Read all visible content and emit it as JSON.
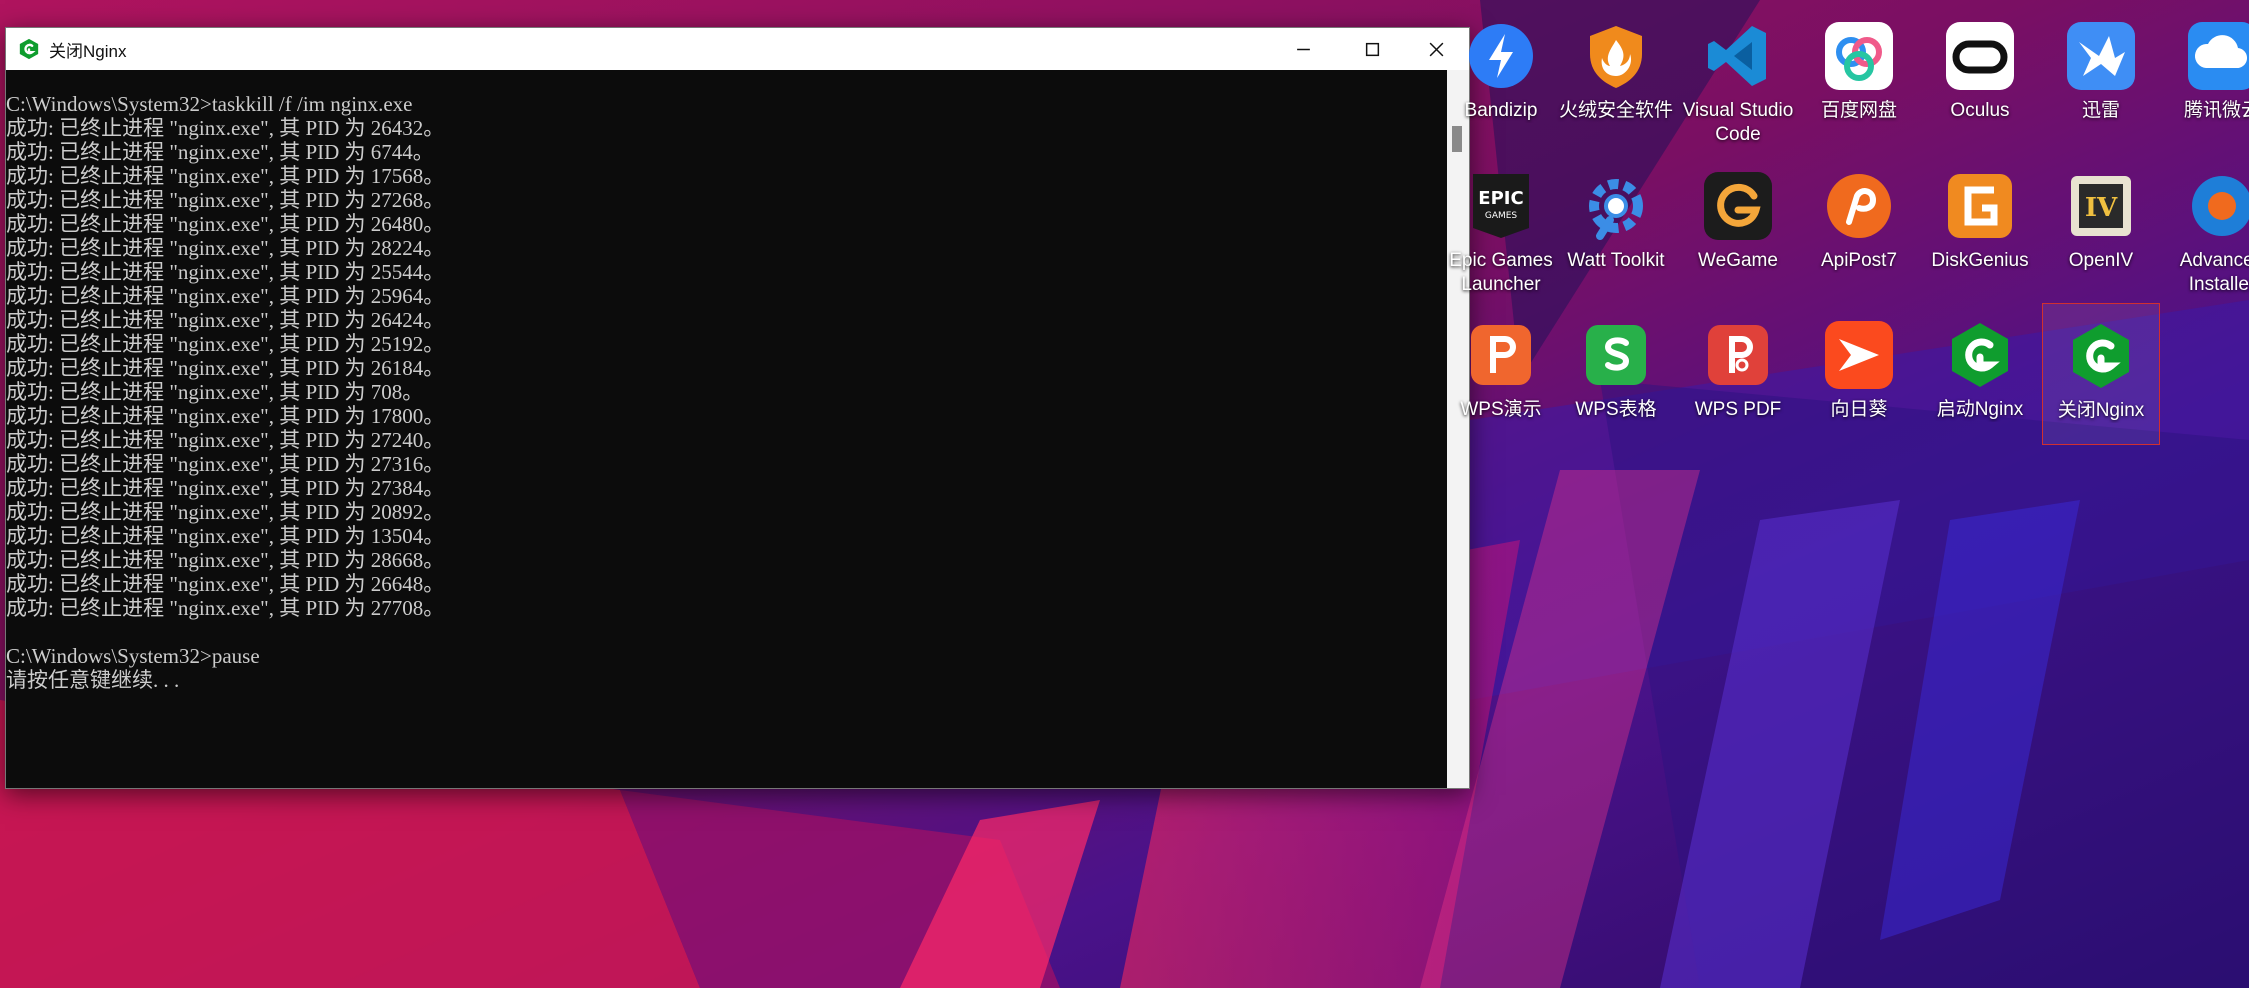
{
  "window": {
    "title": "关闭Nginx",
    "console_lines": [
      "C:\\Windows\\System32>taskkill /f /im nginx.exe",
      "成功: 已终止进程 \"nginx.exe\", 其 PID 为 26432。",
      "成功: 已终止进程 \"nginx.exe\", 其 PID 为 6744。",
      "成功: 已终止进程 \"nginx.exe\", 其 PID 为 17568。",
      "成功: 已终止进程 \"nginx.exe\", 其 PID 为 27268。",
      "成功: 已终止进程 \"nginx.exe\", 其 PID 为 26480。",
      "成功: 已终止进程 \"nginx.exe\", 其 PID 为 28224。",
      "成功: 已终止进程 \"nginx.exe\", 其 PID 为 25544。",
      "成功: 已终止进程 \"nginx.exe\", 其 PID 为 25964。",
      "成功: 已终止进程 \"nginx.exe\", 其 PID 为 26424。",
      "成功: 已终止进程 \"nginx.exe\", 其 PID 为 25192。",
      "成功: 已终止进程 \"nginx.exe\", 其 PID 为 26184。",
      "成功: 已终止进程 \"nginx.exe\", 其 PID 为 708。",
      "成功: 已终止进程 \"nginx.exe\", 其 PID 为 17800。",
      "成功: 已终止进程 \"nginx.exe\", 其 PID 为 27240。",
      "成功: 已终止进程 \"nginx.exe\", 其 PID 为 27316。",
      "成功: 已终止进程 \"nginx.exe\", 其 PID 为 27384。",
      "成功: 已终止进程 \"nginx.exe\", 其 PID 为 20892。",
      "成功: 已终止进程 \"nginx.exe\", 其 PID 为 13504。",
      "成功: 已终止进程 \"nginx.exe\", 其 PID 为 28668。",
      "成功: 已终止进程 \"nginx.exe\", 其 PID 为 26648。",
      "成功: 已终止进程 \"nginx.exe\", 其 PID 为 27708。",
      "",
      "C:\\Windows\\System32>pause",
      "请按任意键继续. . ."
    ]
  },
  "desktop": {
    "icons": [
      {
        "label": "Bandizip",
        "icon": "bandizip-icon",
        "selected": false
      },
      {
        "label": "火绒安全软件",
        "icon": "huorong-icon",
        "selected": false
      },
      {
        "label": "Visual Studio Code",
        "icon": "vscode-icon",
        "selected": false
      },
      {
        "label": "百度网盘",
        "icon": "baidu-netdisk-icon",
        "selected": false
      },
      {
        "label": "Oculus",
        "icon": "oculus-icon",
        "selected": false
      },
      {
        "label": "迅雷",
        "icon": "xunlei-icon",
        "selected": false
      },
      {
        "label": "腾讯微云",
        "icon": "weiyun-icon",
        "selected": false
      },
      {
        "label": "Epic Games Launcher",
        "icon": "epic-games-icon",
        "selected": false
      },
      {
        "label": "Watt Toolkit",
        "icon": "watt-toolkit-icon",
        "selected": false
      },
      {
        "label": "WeGame",
        "icon": "wegame-icon",
        "selected": false
      },
      {
        "label": "ApiPost7",
        "icon": "apipost-icon",
        "selected": false
      },
      {
        "label": "DiskGenius",
        "icon": "diskgenius-icon",
        "selected": false
      },
      {
        "label": "OpenIV",
        "icon": "openiv-icon",
        "selected": false
      },
      {
        "label": "Advanced Installer",
        "icon": "advanced-installer-icon",
        "selected": false
      },
      {
        "label": "WPS演示",
        "icon": "wps-presentation-icon",
        "selected": false
      },
      {
        "label": "WPS表格",
        "icon": "wps-spreadsheet-icon",
        "selected": false
      },
      {
        "label": "WPS PDF",
        "icon": "wps-pdf-icon",
        "selected": false
      },
      {
        "label": "向日葵",
        "icon": "sunlogin-icon",
        "selected": false
      },
      {
        "label": "启动Nginx",
        "icon": "nginx-icon",
        "selected": false
      },
      {
        "label": "关闭Nginx",
        "icon": "nginx-icon",
        "selected": true
      }
    ]
  },
  "colors": {
    "console_bg": "#0c0c0c",
    "console_text": "#cccccc",
    "titlebar_bg": "#ffffff",
    "nginx_green": "#0f9d2e",
    "selection_border": "#d03030"
  }
}
